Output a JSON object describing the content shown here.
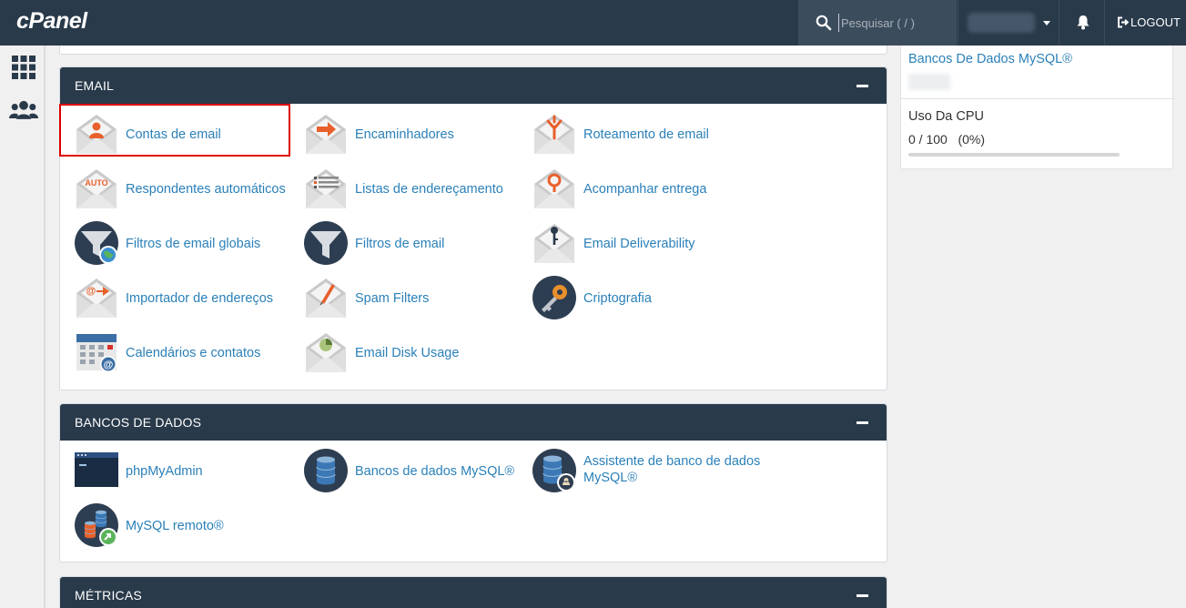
{
  "brand": "cPanel",
  "search": {
    "placeholder": "Pesquisar ( / )"
  },
  "header": {
    "logout_label": "LOGOUT"
  },
  "rail": {
    "items": [
      "grid-icon",
      "users-icon"
    ]
  },
  "stats": {
    "db_link": "Bancos De Dados MySQL®",
    "cpu_title": "Uso Da CPU",
    "cpu_value": "0 / 100   (0%)",
    "cpu_fraction": 0
  },
  "email": {
    "title": "EMAIL",
    "items": [
      {
        "label": "Contas de email",
        "icon": "email-accounts-icon",
        "selected": true
      },
      {
        "label": "Encaminhadores",
        "icon": "forwarders-icon"
      },
      {
        "label": "Roteamento de email",
        "icon": "email-routing-icon"
      },
      {
        "label": "Respondentes automáticos",
        "icon": "autoresponders-icon"
      },
      {
        "label": "Listas de endereçamento",
        "icon": "mailing-lists-icon"
      },
      {
        "label": "Acompanhar entrega",
        "icon": "track-delivery-icon"
      },
      {
        "label": "Filtros de email globais",
        "icon": "global-email-filters-icon"
      },
      {
        "label": "Filtros de email",
        "icon": "email-filters-icon"
      },
      {
        "label": "Email Deliverability",
        "icon": "email-deliverability-icon"
      },
      {
        "label": "Importador de endereços",
        "icon": "address-importer-icon"
      },
      {
        "label": "Spam Filters",
        "icon": "spam-filters-icon"
      },
      {
        "label": "Criptografia",
        "icon": "encryption-icon"
      },
      {
        "label": "Calendários e contatos",
        "icon": "calendars-contacts-icon"
      },
      {
        "label": "Email Disk Usage",
        "icon": "email-disk-usage-icon"
      }
    ]
  },
  "databases": {
    "title": "BANCOS DE DADOS",
    "items": [
      {
        "label": "phpMyAdmin",
        "icon": "phpmyadmin-icon"
      },
      {
        "label": "Bancos de dados MySQL®",
        "icon": "mysql-databases-icon"
      },
      {
        "label": "Assistente de banco de dados MySQL®",
        "icon": "mysql-wizard-icon"
      },
      {
        "label": "MySQL remoto®",
        "icon": "remote-mysql-icon"
      }
    ]
  },
  "metrics": {
    "title": "MÉTRICAS"
  },
  "colors": {
    "header": "#293a4a",
    "link": "#2a80b9",
    "accent": "#e8602c"
  }
}
